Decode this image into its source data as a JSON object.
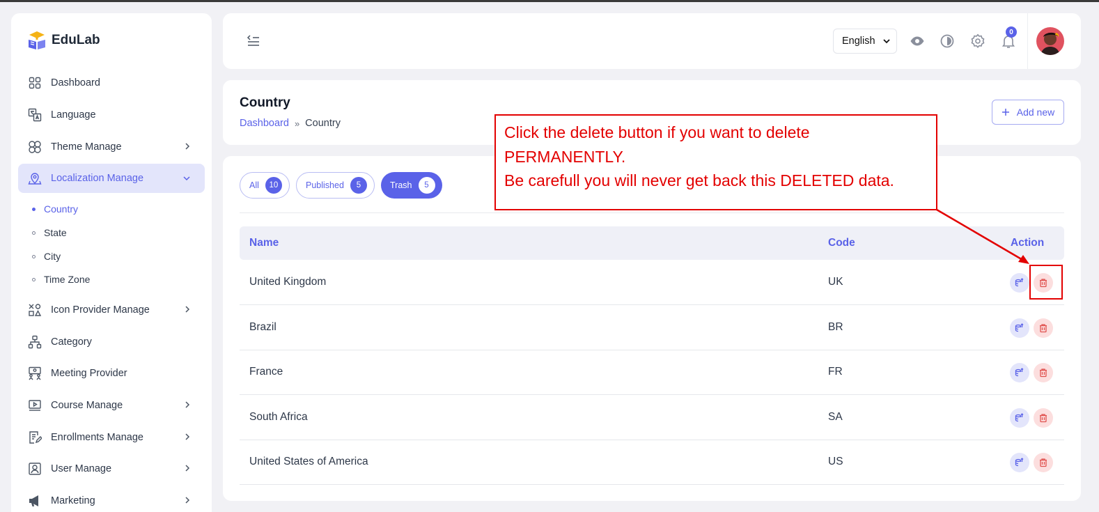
{
  "app": {
    "name": "EduLab"
  },
  "sidebar": {
    "items": [
      {
        "label": "Dashboard",
        "icon": "grid-icon"
      },
      {
        "label": "Language",
        "icon": "translate-icon"
      },
      {
        "label": "Theme Manage",
        "icon": "theme-icon"
      },
      {
        "label": "Localization Manage",
        "icon": "location-pin-icon"
      },
      {
        "label": "Icon Provider Manage",
        "icon": "shapes-icon"
      },
      {
        "label": "Category",
        "icon": "hierarchy-icon"
      },
      {
        "label": "Meeting Provider",
        "icon": "meeting-icon"
      },
      {
        "label": "Course Manage",
        "icon": "video-play-icon"
      },
      {
        "label": "Enrollments Manage",
        "icon": "document-edit-icon"
      },
      {
        "label": "User Manage",
        "icon": "user-frame-icon"
      },
      {
        "label": "Marketing",
        "icon": "megaphone-icon"
      }
    ],
    "subitems": [
      {
        "label": "Country"
      },
      {
        "label": "State"
      },
      {
        "label": "City"
      },
      {
        "label": "Time Zone"
      }
    ]
  },
  "header": {
    "language": "English",
    "notification_count": "0"
  },
  "page": {
    "title": "Country",
    "breadcrumb": {
      "home": "Dashboard",
      "separator": "»",
      "current": "Country"
    },
    "add_button": "Add new"
  },
  "tabs": [
    {
      "label": "All",
      "count": "10"
    },
    {
      "label": "Published",
      "count": "5"
    },
    {
      "label": "Trash",
      "count": "5"
    }
  ],
  "table": {
    "headers": {
      "name": "Name",
      "code": "Code",
      "action": "Action"
    },
    "rows": [
      {
        "name": "United Kingdom",
        "code": "UK"
      },
      {
        "name": "Brazil",
        "code": "BR"
      },
      {
        "name": "France",
        "code": "FR"
      },
      {
        "name": "South Africa",
        "code": "SA"
      },
      {
        "name": "United States of America",
        "code": "US"
      }
    ]
  },
  "annotation": {
    "line1": "Click the delete button if you want to delete",
    "line2": "PERMANENTLY.",
    "line3": "Be carefull you will never get back this DELETED data."
  },
  "colors": {
    "accent": "#5a62e8",
    "annotation": "#e30000",
    "delete": "#e0524f"
  }
}
